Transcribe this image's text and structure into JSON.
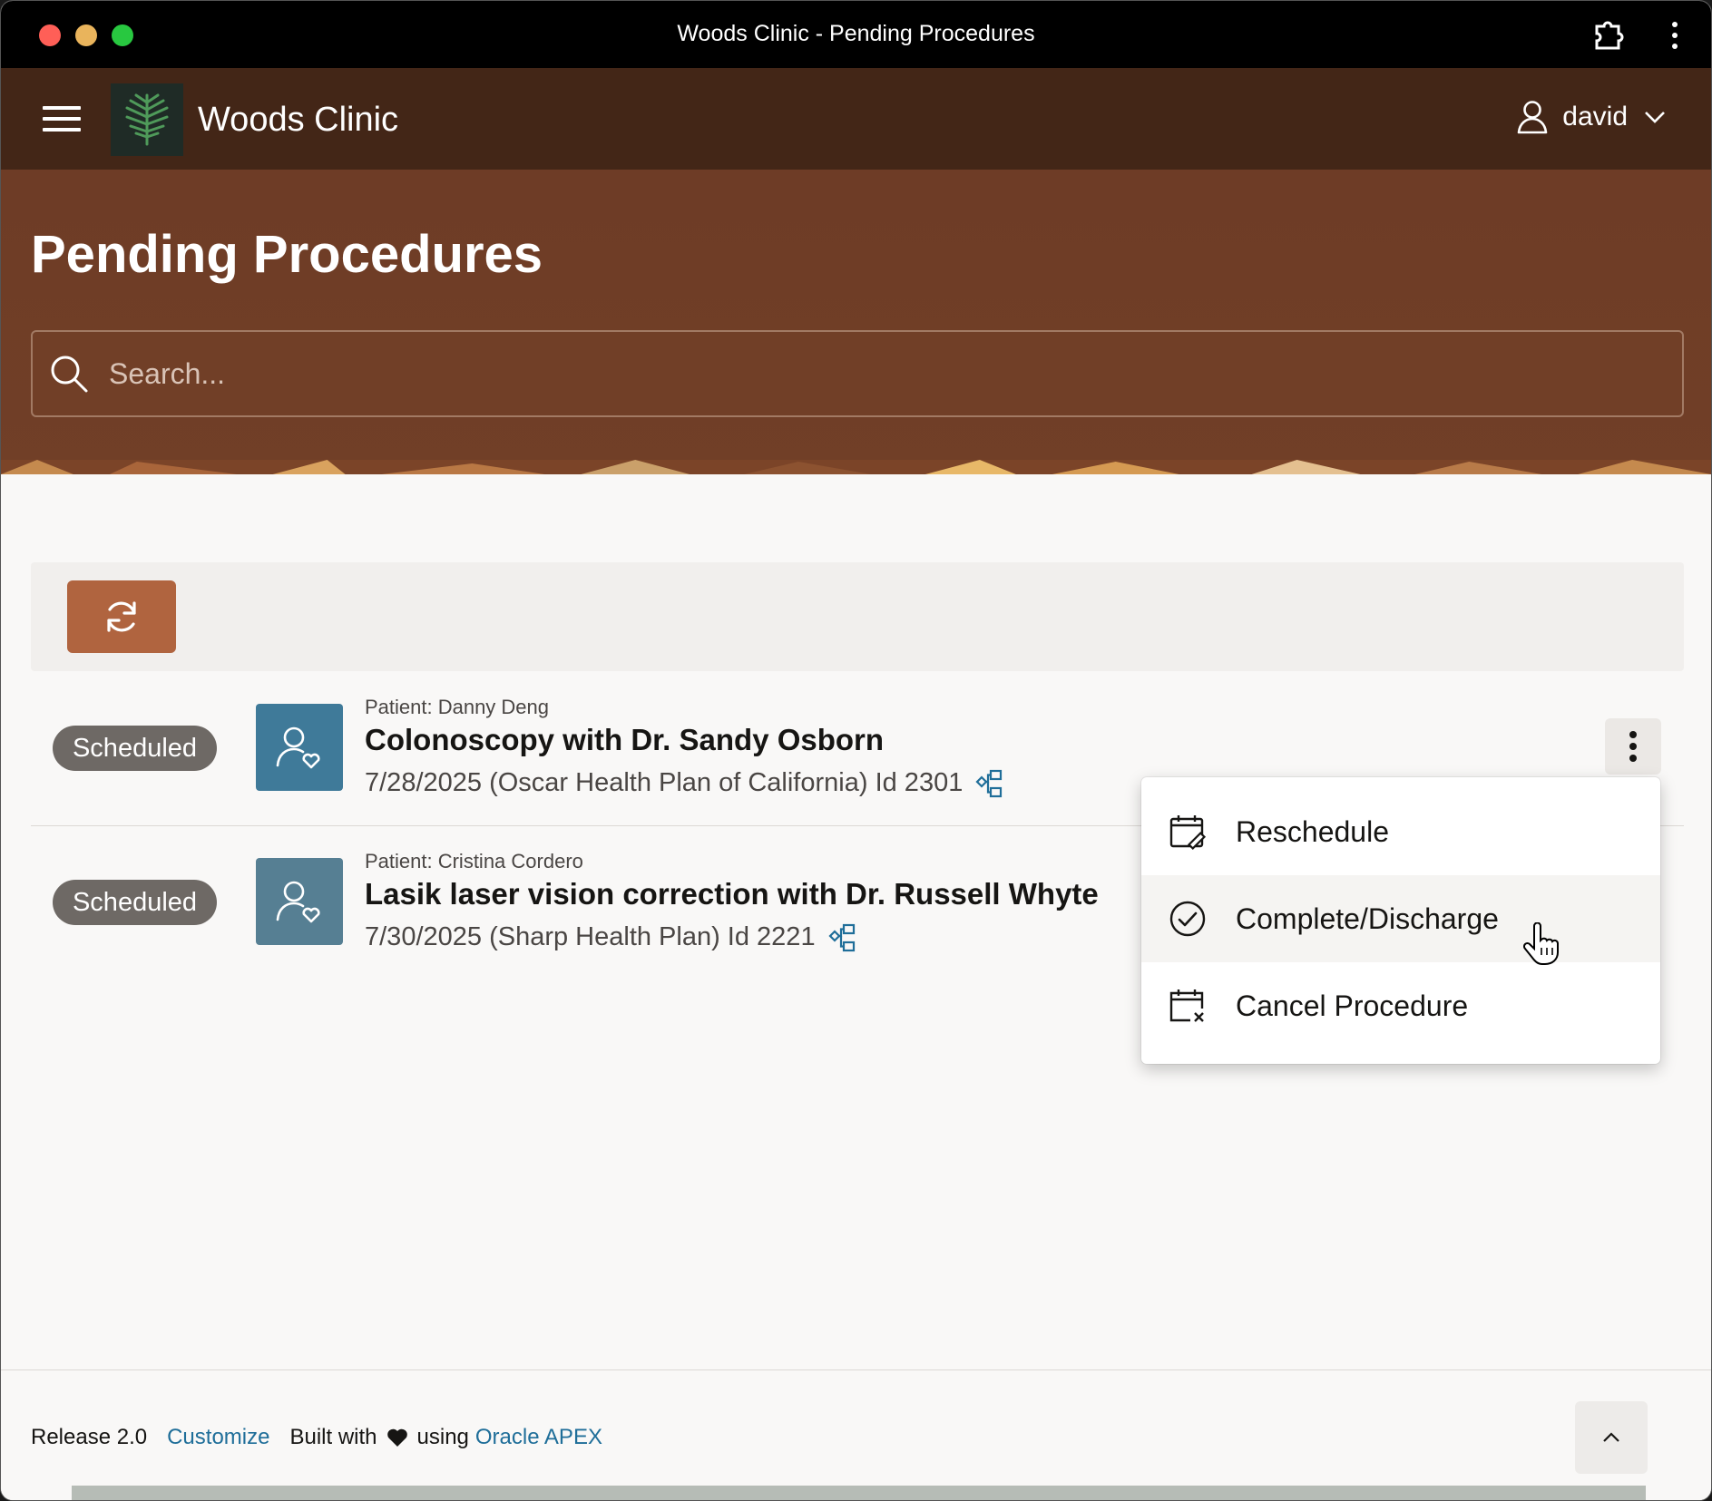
{
  "window": {
    "title": "Woods Clinic - Pending Procedures"
  },
  "header": {
    "app_title": "Woods Clinic",
    "user": "david"
  },
  "page": {
    "title": "Pending Procedures"
  },
  "search": {
    "placeholder": "Search..."
  },
  "procedures": [
    {
      "status": "Scheduled",
      "patient": "Patient: Danny Deng",
      "title": "Colonoscopy with Dr. Sandy Osborn",
      "meta": "7/28/2025 (Oscar Health Plan of California) Id 2301"
    },
    {
      "status": "Scheduled",
      "patient": "Patient: Cristina Cordero",
      "title": "Lasik laser vision correction with Dr. Russell Whyte",
      "meta": "7/30/2025 (Sharp Health Plan) Id 2221"
    }
  ],
  "menu": {
    "items": [
      "Reschedule",
      "Complete/Discharge",
      "Cancel Procedure"
    ],
    "hovered": "Complete/Discharge"
  },
  "footer": {
    "release": "Release 2.0",
    "customize": "Customize",
    "built_with": "Built with",
    "using": "using",
    "apex": "Oracle APEX"
  },
  "colors": {
    "header_bg": "#432617",
    "hero_bg": "#713f27",
    "accent_button": "#b0643f",
    "badge": "#6e6965",
    "link": "#1f6e99"
  },
  "icons": [
    "extension-icon",
    "more-vertical-icon",
    "hamburger-icon",
    "tree-logo-icon",
    "user-icon",
    "chevron-down-icon",
    "search-icon",
    "refresh-icon",
    "patient-heart-icon",
    "hierarchy-link-icon",
    "calendar-edit-icon",
    "check-circle-icon",
    "calendar-cancel-icon",
    "heart-icon",
    "chevron-up-icon"
  ]
}
